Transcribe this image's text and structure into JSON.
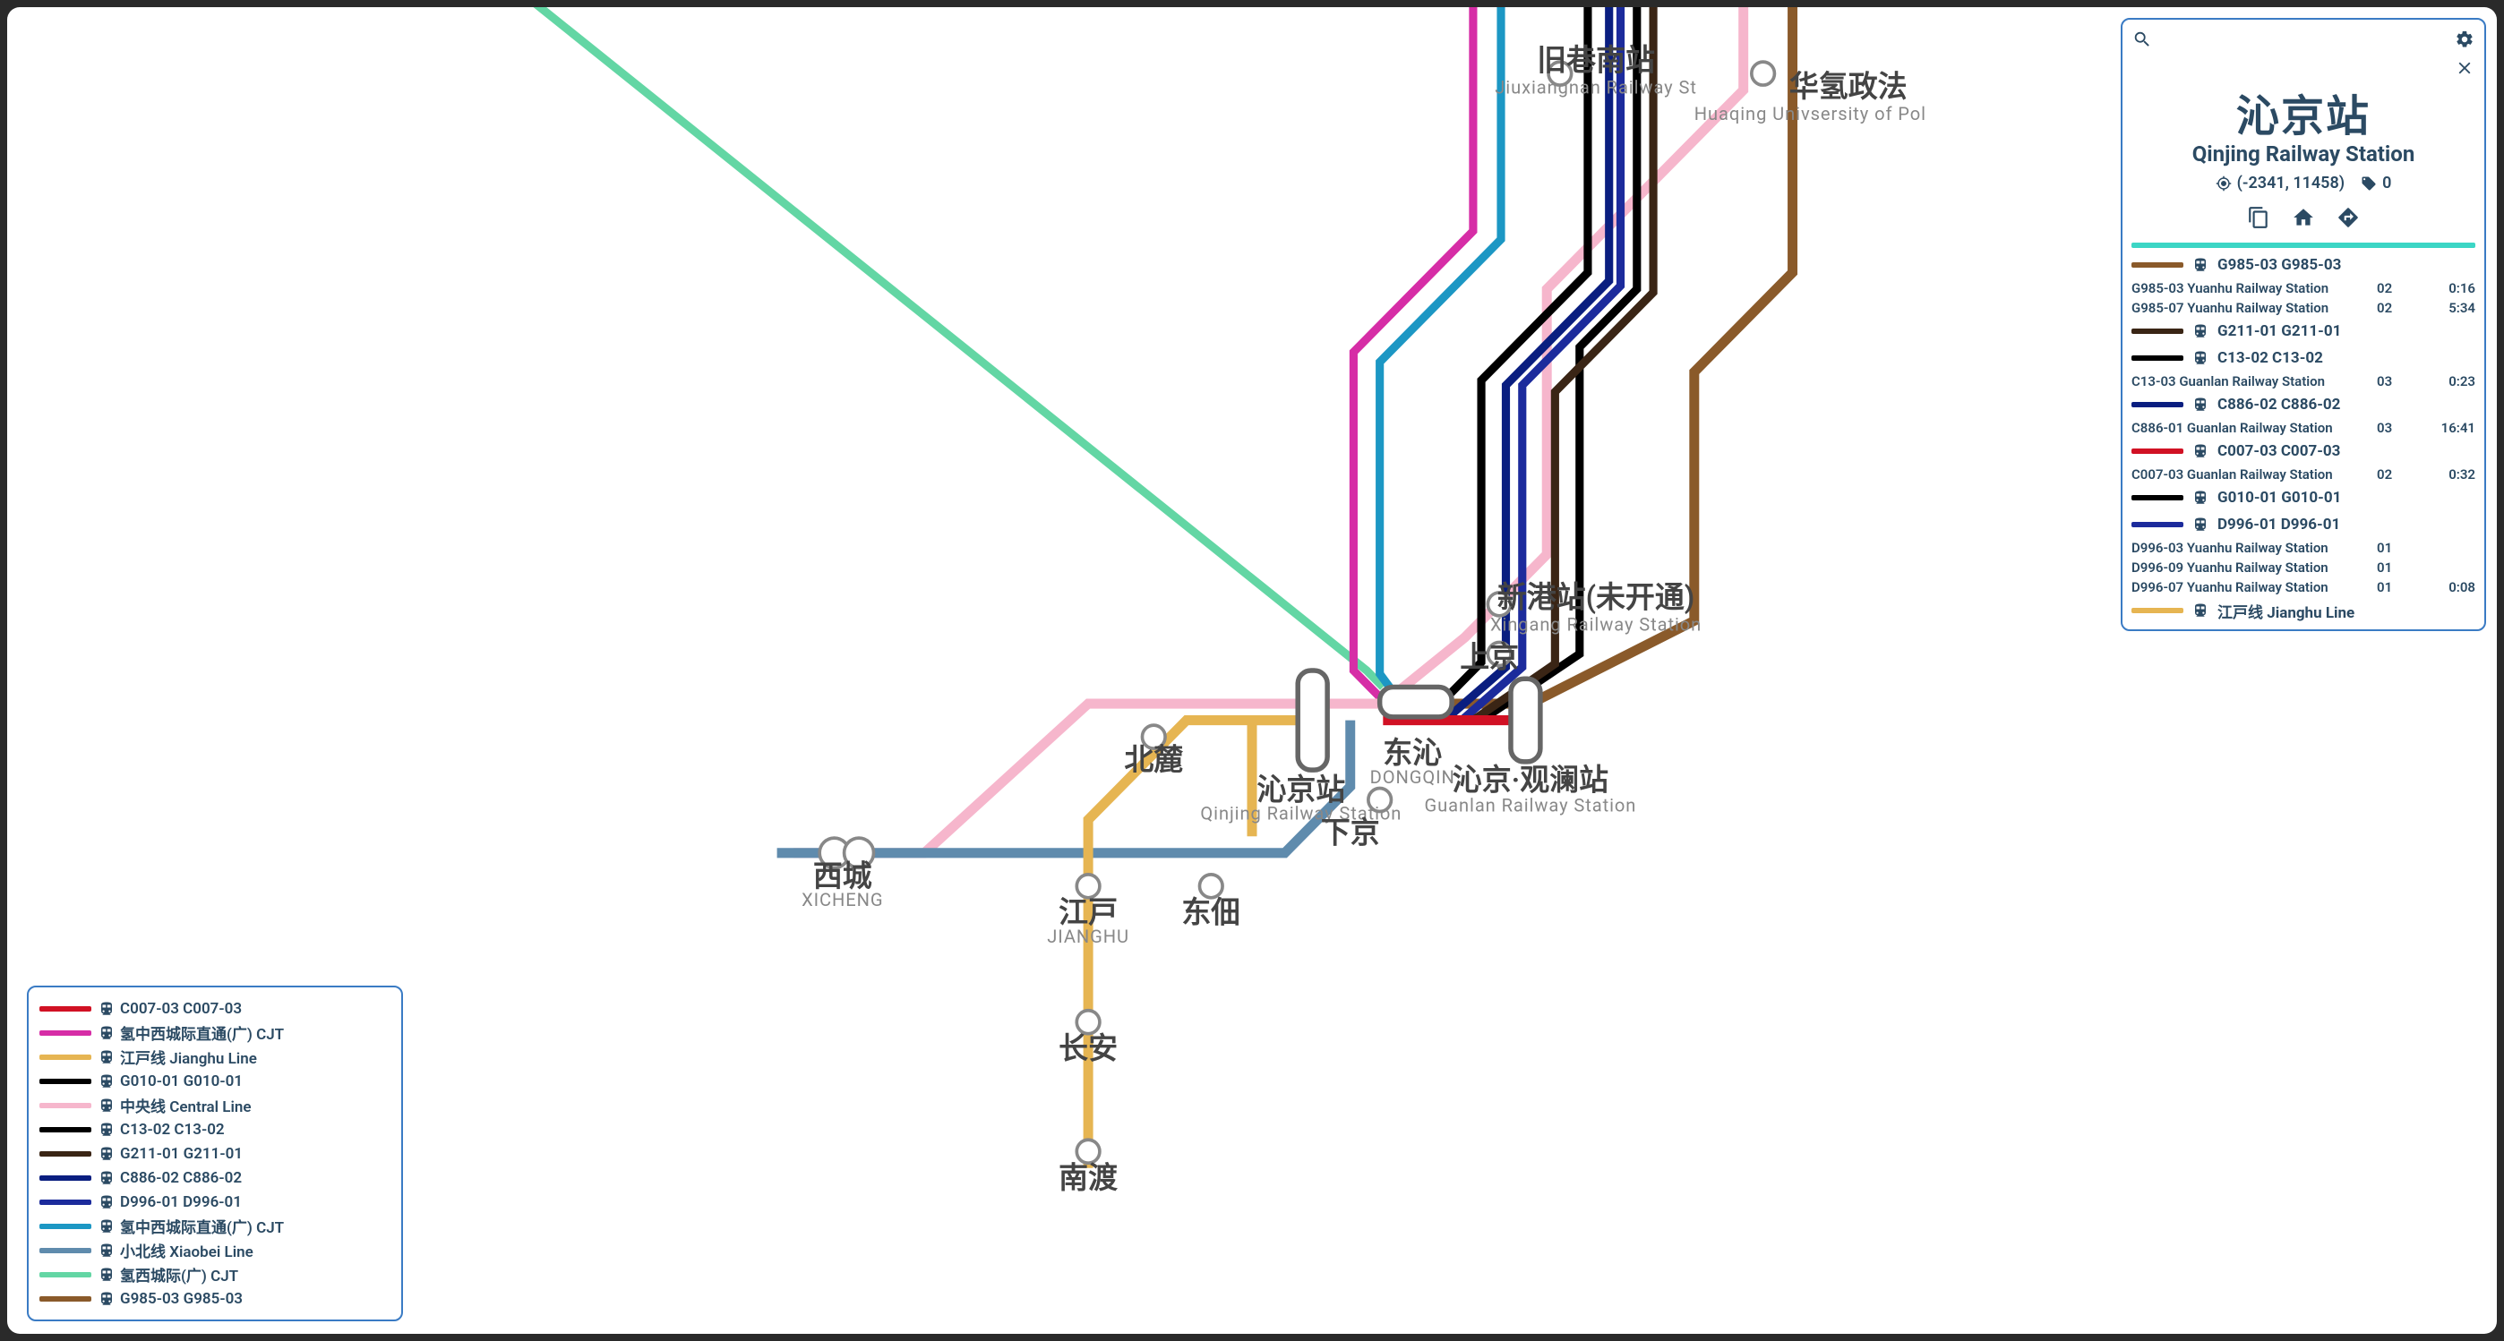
{
  "panel": {
    "title_cn": "沁京站",
    "title_en": "Qinjing Railway Station",
    "coords": "(-2341, 11458)",
    "tag": "0"
  },
  "legend": [
    {
      "color": "#d11124",
      "label": "C007-03 C007-03"
    },
    {
      "color": "#d62da6",
      "label": "氢中西城际直通(广) CJT"
    },
    {
      "color": "#e6b552",
      "label": "江戸线 Jianghu Line"
    },
    {
      "color": "#000000",
      "label": "G010-01 G010-01"
    },
    {
      "color": "#f6b6cc",
      "label": "中央线 Central Line"
    },
    {
      "color": "#000000",
      "label": "C13-02 C13-02"
    },
    {
      "color": "#3a2515",
      "label": "G211-01 G211-01"
    },
    {
      "color": "#0a1e80",
      "label": "C886-02 C886-02"
    },
    {
      "color": "#1c2b9c",
      "label": "D996-01 D996-01"
    },
    {
      "color": "#1c97c4",
      "label": "氢中西城际直通(广) CJT"
    },
    {
      "color": "#5f8bad",
      "label": "小北线 Xiaobei Line"
    },
    {
      "color": "#63d6a4",
      "label": "氢西城际(广) CJT"
    },
    {
      "color": "#8a5a2a",
      "label": "G985-03 G985-03"
    }
  ],
  "routes": [
    {
      "color": "#8a5a2a",
      "label": "G985-03 G985-03",
      "deps": [
        {
          "dest": "G985-03 Yuanhu Railway Station",
          "plat": "02",
          "eta": "0:16"
        },
        {
          "dest": "G985-07 Yuanhu Railway Station",
          "plat": "02",
          "eta": "5:34"
        }
      ]
    },
    {
      "color": "#3a2515",
      "label": "G211-01 G211-01",
      "deps": []
    },
    {
      "color": "#000000",
      "label": "C13-02 C13-02",
      "deps": [
        {
          "dest": "C13-03 Guanlan Railway Station",
          "plat": "03",
          "eta": "0:23"
        }
      ]
    },
    {
      "color": "#0a1e80",
      "label": "C886-02 C886-02",
      "deps": [
        {
          "dest": "C886-01 Guanlan Railway Station",
          "plat": "03",
          "eta": "16:41"
        }
      ]
    },
    {
      "color": "#d11124",
      "label": "C007-03 C007-03",
      "deps": [
        {
          "dest": "C007-03 Guanlan Railway Station",
          "plat": "02",
          "eta": "0:32"
        }
      ]
    },
    {
      "color": "#000000",
      "label": "G010-01 G010-01",
      "deps": []
    },
    {
      "color": "#1c2b9c",
      "label": "D996-01 D996-01",
      "deps": [
        {
          "dest": "D996-03 Yuanhu Railway Station",
          "plat": "01",
          "eta": ""
        },
        {
          "dest": "D996-09 Yuanhu Railway Station",
          "plat": "01",
          "eta": ""
        },
        {
          "dest": "D996-07 Yuanhu Railway Station",
          "plat": "01",
          "eta": "0:08"
        }
      ]
    },
    {
      "color": "#e6b552",
      "label": "江戸线 Jianghu Line",
      "deps": []
    }
  ],
  "stations": {
    "jiuxiangnan_cn": "旧巷南站",
    "jiuxiangnan_en": "Jiuxiangnan Railway St",
    "huaqing_cn": "华氢政法",
    "huaqing_en": "Huaqing Univsersity of Pol",
    "xingang_cn": "新港站(未开通)",
    "xingang_en": "Xingang Railway Station",
    "shangjing_cn": "上京",
    "dongqin_cn": "东沁",
    "dongqin_en": "DONGQIN",
    "qinjing_cn": "沁京站",
    "qinjing_en": "Qinjing Railway Station",
    "guanlan_cn": "沁京·观澜站",
    "guanlan_en": "Guanlan Railway Station",
    "xiajing_cn": "下京",
    "beilu_cn": "北麓",
    "jianghu_cn": "江戸",
    "jianghu_en": "JIANGHU",
    "dongtian_cn": "东佃",
    "changan_cn": "长安",
    "nandu_cn": "南渡",
    "xicheng_cn": "西城",
    "xicheng_en": "XICHENG"
  }
}
